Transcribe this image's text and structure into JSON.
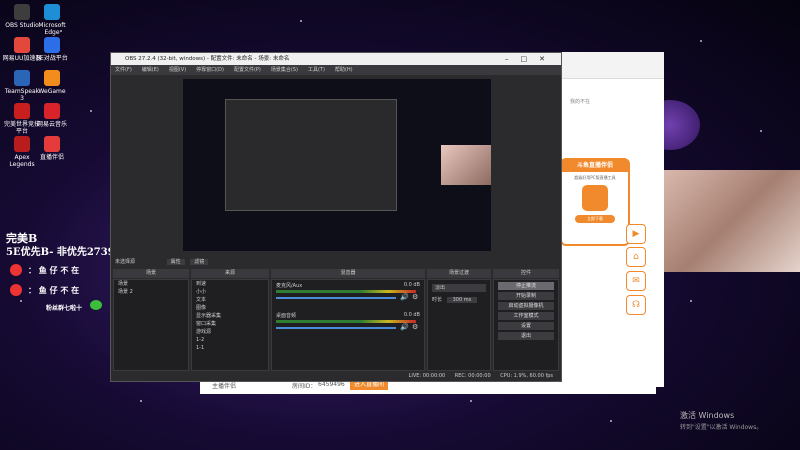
{
  "desktop_icons": [
    {
      "label": "OBS Studio",
      "color": "#3d3d3d"
    },
    {
      "label": "Microsoft Edge",
      "color": "#1e8fd6"
    },
    {
      "label": "网易UU加速器",
      "color": "#e4473c"
    },
    {
      "label": "5E对战平台",
      "color": "#2c6ee8"
    },
    {
      "label": "TeamSpeak 3",
      "color": "#2b65b8"
    },
    {
      "label": "WeGame",
      "color": "#f28c1c"
    },
    {
      "label": "完美世界竞技平台",
      "color": "#c81e1e"
    },
    {
      "label": "网易云音乐",
      "color": "#d8232a"
    },
    {
      "label": "Apex Legends",
      "color": "#b81c1c"
    },
    {
      "label": "直播伴侣",
      "color": "#e63b3b"
    }
  ],
  "overlay": {
    "name": "完美B",
    "rank": "5E优先B- 非优先2739",
    "weibo_line": "： 鱼 仔 不 在",
    "netease_line": "： 鱼 仔 不 在",
    "wechat_line": "粉丝群七啦十"
  },
  "obs": {
    "title": "OBS 27.2.4 (32-bit, windows) - 配置文件: 未命名 - 场景: 未命名",
    "menu": [
      "文件(F)",
      "编辑(E)",
      "视图(V)",
      "停靠窗口(D)",
      "配置文件(P)",
      "场景集合(S)",
      "工具(T)",
      "帮助(H)"
    ],
    "source_bar": "未选择源",
    "source_props": "属性",
    "source_filters": "滤镜",
    "docks": {
      "scenes": "场景",
      "sources": "来源",
      "mixer": "混音器",
      "transitions": "场景过渡",
      "controls": "控件"
    },
    "scenes": [
      "场景",
      "场景 2"
    ],
    "sources": [
      "到速",
      "小小",
      "文本",
      "图像",
      "显示器采集",
      "窗口采集",
      "游戏源",
      "1-2",
      "1-1"
    ],
    "mixer": [
      {
        "name": "麦克风/Aux",
        "db": "0.0 dB"
      },
      {
        "name": "桌面音频",
        "db": "0.0 dB"
      }
    ],
    "transition": {
      "type": "淡出",
      "duration_label": "时长",
      "duration": "300 ms"
    },
    "controls": [
      "停止推流",
      "开始录制",
      "启动虚拟摄像机",
      "工作室模式",
      "设置",
      "退出"
    ],
    "status": {
      "live": "LIVE: 00:00:00",
      "rec": "REC: 00:00:00",
      "cpu": "CPU: 1.9%, 60.00 fps"
    }
  },
  "browser": {
    "tab_label": "我的不在",
    "promo_title": "斗鱼直播伴侣",
    "promo_sub": "超级好用PC版直播工具",
    "promo_btn": "立即下载",
    "room_label": "主播伴侣",
    "room_id_label": "房间ID：",
    "room_id": "6459496",
    "enter_btn": "进入直播间"
  },
  "watermark": {
    "line1": "激活 Windows",
    "line2": "转到\"设置\"以激活 Windows。"
  },
  "colors": {
    "accent": "#f08a2c",
    "obs_bg": "#2b2b2e"
  }
}
